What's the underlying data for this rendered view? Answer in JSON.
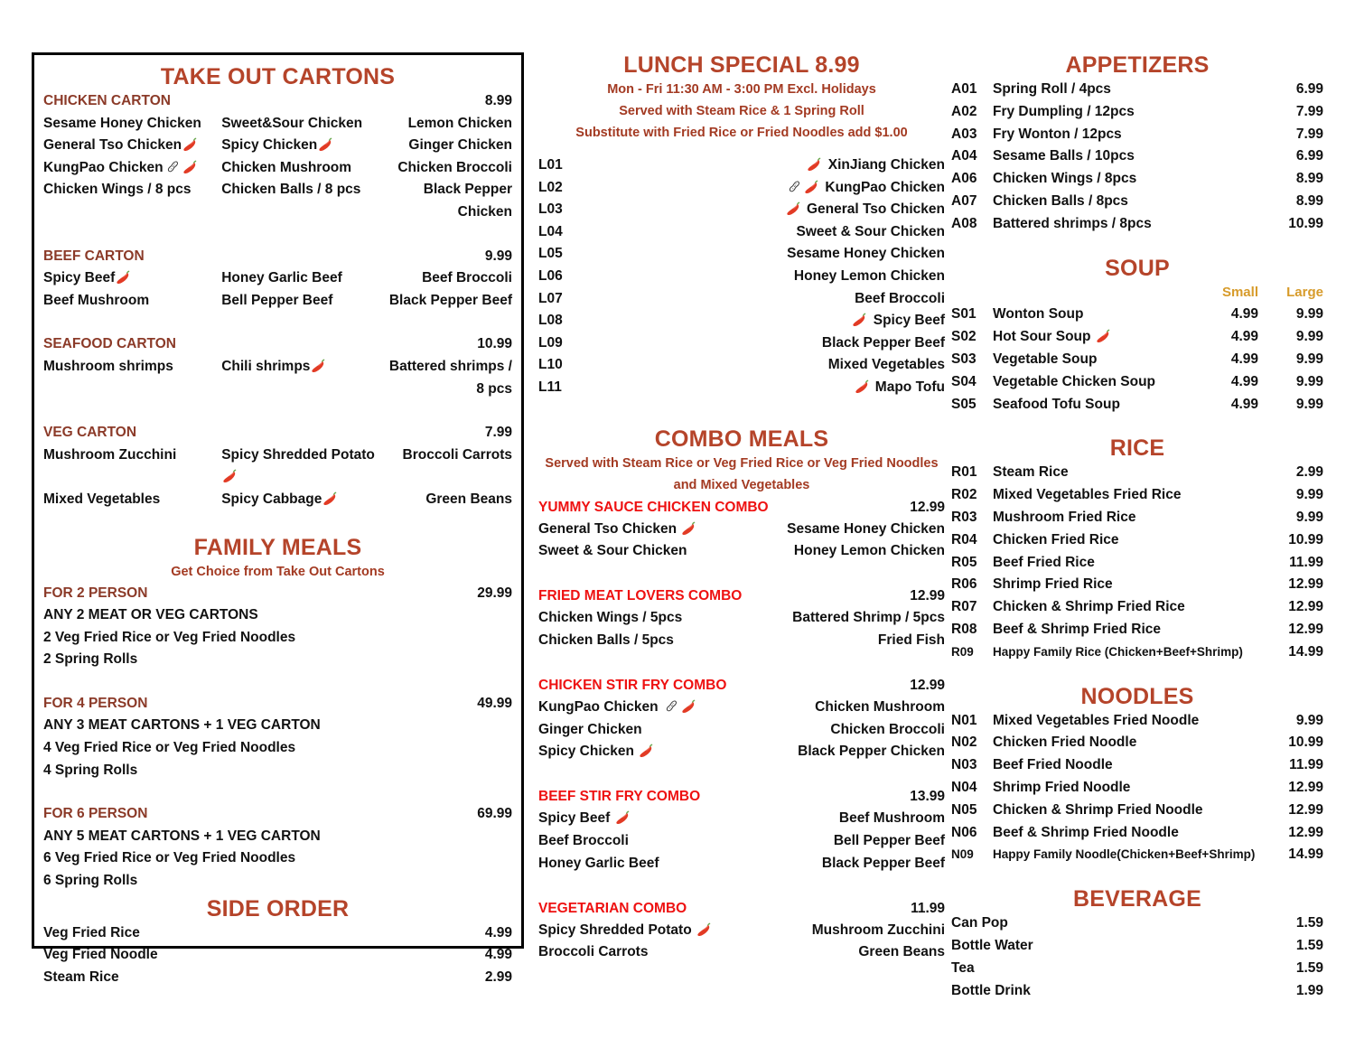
{
  "colors": {
    "heading": "#b5442a",
    "category": "#8b3a28",
    "combo_red": "#ee1111",
    "soup_size": "#d79b2a",
    "text": "#111111"
  },
  "left_panel": {
    "title": "TAKE OUT CARTONS",
    "cartons": [
      {
        "name": "CHICKEN CARTON",
        "price": "8.99",
        "rows": [
          [
            {
              "label": "Sesame Honey Chicken"
            },
            {
              "label": "Sweet&Sour Chicken"
            },
            {
              "label": "Lemon Chicken"
            }
          ],
          [
            {
              "label": "General Tso Chicken",
              "chili": true
            },
            {
              "label": "Spicy Chicken",
              "chili": true
            },
            {
              "label": "Ginger Chicken"
            }
          ],
          [
            {
              "label": "KungPao Chicken",
              "peanut": true,
              "chili": true
            },
            {
              "label": "Chicken Mushroom"
            },
            {
              "label": "Chicken Broccoli"
            }
          ],
          [
            {
              "label": "Chicken Wings / 8 pcs"
            },
            {
              "label": "Chicken Balls / 8 pcs"
            },
            {
              "label": "Black Pepper Chicken"
            }
          ]
        ]
      },
      {
        "name": "BEEF CARTON",
        "price": "9.99",
        "rows": [
          [
            {
              "label": "Spicy Beef",
              "chili": true
            },
            {
              "label": "Honey Garlic Beef"
            },
            {
              "label": "Beef Broccoli"
            }
          ],
          [
            {
              "label": "Beef Mushroom"
            },
            {
              "label": "Bell Pepper Beef"
            },
            {
              "label": "Black Pepper Beef"
            }
          ]
        ]
      },
      {
        "name": "SEAFOOD CARTON",
        "price": "10.99",
        "rows": [
          [
            {
              "label": "Mushroom shrimps"
            },
            {
              "label": "Chili shrimps",
              "chili": true
            },
            {
              "label": "Battered shrimps / 8 pcs"
            }
          ]
        ]
      },
      {
        "name": "VEG CARTON",
        "price": "7.99",
        "rows": [
          [
            {
              "label": "Mushroom Zucchini"
            },
            {
              "label": "Spicy Shredded Potato",
              "chili": true
            },
            {
              "label": "Broccoli Carrots"
            }
          ],
          [
            {
              "label": "Mixed Vegetables"
            },
            {
              "label": "Spicy Cabbage",
              "chili": true
            },
            {
              "label": "Green Beans"
            }
          ]
        ]
      }
    ],
    "family": {
      "title": "FAMILY MEALS",
      "subtitle": "Get Choice from Take Out Cartons",
      "packages": [
        {
          "name": "FOR 2 PERSON",
          "price": "29.99",
          "lines": [
            "ANY 2 MEAT OR VEG CARTONS",
            "2 Veg Fried Rice or Veg Fried Noodles",
            "2 Spring Rolls"
          ]
        },
        {
          "name": "FOR 4 PERSON",
          "price": "49.99",
          "lines": [
            "ANY 3 MEAT CARTONS + 1 VEG CARTON",
            "4 Veg Fried Rice or Veg Fried Noodles",
            "4 Spring Rolls"
          ]
        },
        {
          "name": "FOR 6 PERSON",
          "price": "69.99",
          "lines": [
            "ANY 5 MEAT CARTONS + 1 VEG CARTON",
            "6 Veg Fried Rice or Veg Fried Noodles",
            "6 Spring Rolls"
          ]
        }
      ]
    },
    "side_order": {
      "title": "SIDE ORDER",
      "items": [
        {
          "name": "Veg Fried Rice",
          "price": "4.99"
        },
        {
          "name": "Veg Fried Noodle",
          "price": "4.99"
        },
        {
          "name": "Steam Rice",
          "price": "2.99"
        }
      ]
    }
  },
  "lunch": {
    "title": "LUNCH SPECIAL  8.99",
    "notes": [
      "Mon - Fri   11:30 AM - 3:00 PM Excl. Holidays",
      "Served with Steam Rice & 1 Spring Roll",
      "Substitute with Fried Rice or Fried Noodles add $1.00"
    ],
    "items": [
      {
        "code": "L01",
        "name": "XinJiang Chicken",
        "chili": true
      },
      {
        "code": "L02",
        "name": "KungPao Chicken",
        "peanut": true,
        "chili": true
      },
      {
        "code": "L03",
        "name": "General Tso Chicken",
        "chili": true
      },
      {
        "code": "L04",
        "name": "Sweet & Sour Chicken"
      },
      {
        "code": "L05",
        "name": "Sesame Honey Chicken"
      },
      {
        "code": "L06",
        "name": "Honey Lemon Chicken"
      },
      {
        "code": "L07",
        "name": "Beef Broccoli"
      },
      {
        "code": "L08",
        "name": "Spicy Beef",
        "chili": true
      },
      {
        "code": "L09",
        "name": "Black Pepper Beef"
      },
      {
        "code": "L10",
        "name": "Mixed Vegetables"
      },
      {
        "code": "L11",
        "name": "Mapo Tofu",
        "chili": true
      }
    ]
  },
  "combo": {
    "title": "COMBO MEALS",
    "notes": [
      "Served with Steam Rice or Veg Fried Rice or Veg Fried Noodles",
      "and Mixed Vegetables"
    ],
    "groups": [
      {
        "name": "YUMMY SAUCE CHICKEN COMBO",
        "price": "12.99",
        "rows": [
          [
            {
              "label": "General Tso Chicken",
              "chili": true
            },
            {
              "label": "Sesame Honey Chicken"
            }
          ],
          [
            {
              "label": "Sweet & Sour Chicken"
            },
            {
              "label": "Honey Lemon Chicken"
            }
          ]
        ]
      },
      {
        "name": "FRIED MEAT LOVERS COMBO",
        "price": "12.99",
        "rows": [
          [
            {
              "label": "Chicken Wings / 5pcs"
            },
            {
              "label": "Battered Shrimp / 5pcs"
            }
          ],
          [
            {
              "label": "Chicken Balls / 5pcs"
            },
            {
              "label": "Fried Fish"
            }
          ]
        ]
      },
      {
        "name": "CHICKEN STIR FRY COMBO",
        "price": "12.99",
        "rows": [
          [
            {
              "label": "KungPao Chicken",
              "peanut": true,
              "chili": true
            },
            {
              "label": "Chicken Mushroom"
            }
          ],
          [
            {
              "label": "Ginger Chicken"
            },
            {
              "label": "Chicken Broccoli"
            }
          ],
          [
            {
              "label": "Spicy Chicken",
              "chili": true
            },
            {
              "label": "Black Pepper Chicken"
            }
          ]
        ]
      },
      {
        "name": "BEEF STIR FRY COMBO",
        "price": "13.99",
        "rows": [
          [
            {
              "label": "Spicy Beef",
              "chili": true
            },
            {
              "label": "Beef Mushroom"
            }
          ],
          [
            {
              "label": "Beef Broccoli"
            },
            {
              "label": "Bell Pepper Beef"
            }
          ],
          [
            {
              "label": "Honey Garlic Beef"
            },
            {
              "label": "Black Pepper Beef"
            }
          ]
        ]
      },
      {
        "name": "VEGETARIAN COMBO",
        "price": "11.99",
        "rows": [
          [
            {
              "label": "Spicy Shredded Potato",
              "chili": true
            },
            {
              "label": "Mushroom Zucchini"
            }
          ],
          [
            {
              "label": "Broccoli Carrots"
            },
            {
              "label": "Green Beans"
            }
          ]
        ]
      }
    ]
  },
  "appetizers": {
    "title": "APPETIZERS",
    "items": [
      {
        "code": "A01",
        "name": "Spring Roll / 4pcs",
        "price": "6.99"
      },
      {
        "code": "A02",
        "name": "Fry Dumpling / 12pcs",
        "price": "7.99"
      },
      {
        "code": "A03",
        "name": "Fry Wonton / 12pcs",
        "price": "7.99"
      },
      {
        "code": "A04",
        "name": "Sesame Balls / 10pcs",
        "price": "6.99"
      },
      {
        "code": "A06",
        "name": "Chicken Wings / 8pcs",
        "price": "8.99"
      },
      {
        "code": "A07",
        "name": "Chicken Balls / 8pcs",
        "price": "8.99"
      },
      {
        "code": "A08",
        "name": "Battered shrimps / 8pcs",
        "price": "10.99"
      }
    ]
  },
  "soup": {
    "title": "SOUP",
    "size_small": "Small",
    "size_large": "Large",
    "items": [
      {
        "code": "S01",
        "name": "Wonton Soup",
        "small": "4.99",
        "large": "9.99"
      },
      {
        "code": "S02",
        "name": "Hot Sour Soup",
        "chili": true,
        "small": "4.99",
        "large": "9.99"
      },
      {
        "code": "S03",
        "name": "Vegetable Soup",
        "small": "4.99",
        "large": "9.99"
      },
      {
        "code": "S04",
        "name": "Vegetable Chicken Soup",
        "small": "4.99",
        "large": "9.99"
      },
      {
        "code": "S05",
        "name": "Seafood Tofu Soup",
        "small": "4.99",
        "large": "9.99"
      }
    ]
  },
  "rice": {
    "title": "RICE",
    "items": [
      {
        "code": "R01",
        "name": "Steam Rice",
        "price": "2.99"
      },
      {
        "code": "R02",
        "name": "Mixed Vegetables Fried Rice",
        "price": "9.99"
      },
      {
        "code": "R03",
        "name": "Mushroom Fried Rice",
        "price": "9.99"
      },
      {
        "code": "R04",
        "name": "Chicken Fried Rice",
        "price": "10.99"
      },
      {
        "code": "R05",
        "name": "Beef Fried Rice",
        "price": "11.99"
      },
      {
        "code": "R06",
        "name": "Shrimp Fried Rice",
        "price": "12.99"
      },
      {
        "code": "R07",
        "name": "Chicken & Shrimp Fried Rice",
        "price": "12.99"
      },
      {
        "code": "R08",
        "name": "Beef & Shrimp Fried Rice",
        "price": "12.99"
      },
      {
        "code": "R09",
        "name": "Happy Family Rice (Chicken+Beef+Shrimp)",
        "price": "14.99",
        "small_text": true
      }
    ]
  },
  "noodles": {
    "title": "NOODLES",
    "items": [
      {
        "code": "N01",
        "name": "Mixed Vegetables Fried Noodle",
        "price": "9.99"
      },
      {
        "code": "N02",
        "name": "Chicken Fried Noodle",
        "price": "10.99"
      },
      {
        "code": "N03",
        "name": "Beef Fried Noodle",
        "price": "11.99"
      },
      {
        "code": "N04",
        "name": "Shrimp Fried Noodle",
        "price": "12.99"
      },
      {
        "code": "N05",
        "name": "Chicken & Shrimp Fried Noodle",
        "price": "12.99"
      },
      {
        "code": "N06",
        "name": "Beef & Shrimp Fried Noodle",
        "price": "12.99"
      },
      {
        "code": "N09",
        "name": "Happy Family Noodle(Chicken+Beef+Shrimp)",
        "price": "14.99",
        "small_text": true
      }
    ]
  },
  "beverage": {
    "title": "BEVERAGE",
    "items": [
      {
        "name": "Can Pop",
        "price": "1.59"
      },
      {
        "name": "Bottle Water",
        "price": "1.59"
      },
      {
        "name": "Tea",
        "price": "1.59"
      },
      {
        "name": "Bottle Drink",
        "price": "1.99"
      }
    ]
  }
}
